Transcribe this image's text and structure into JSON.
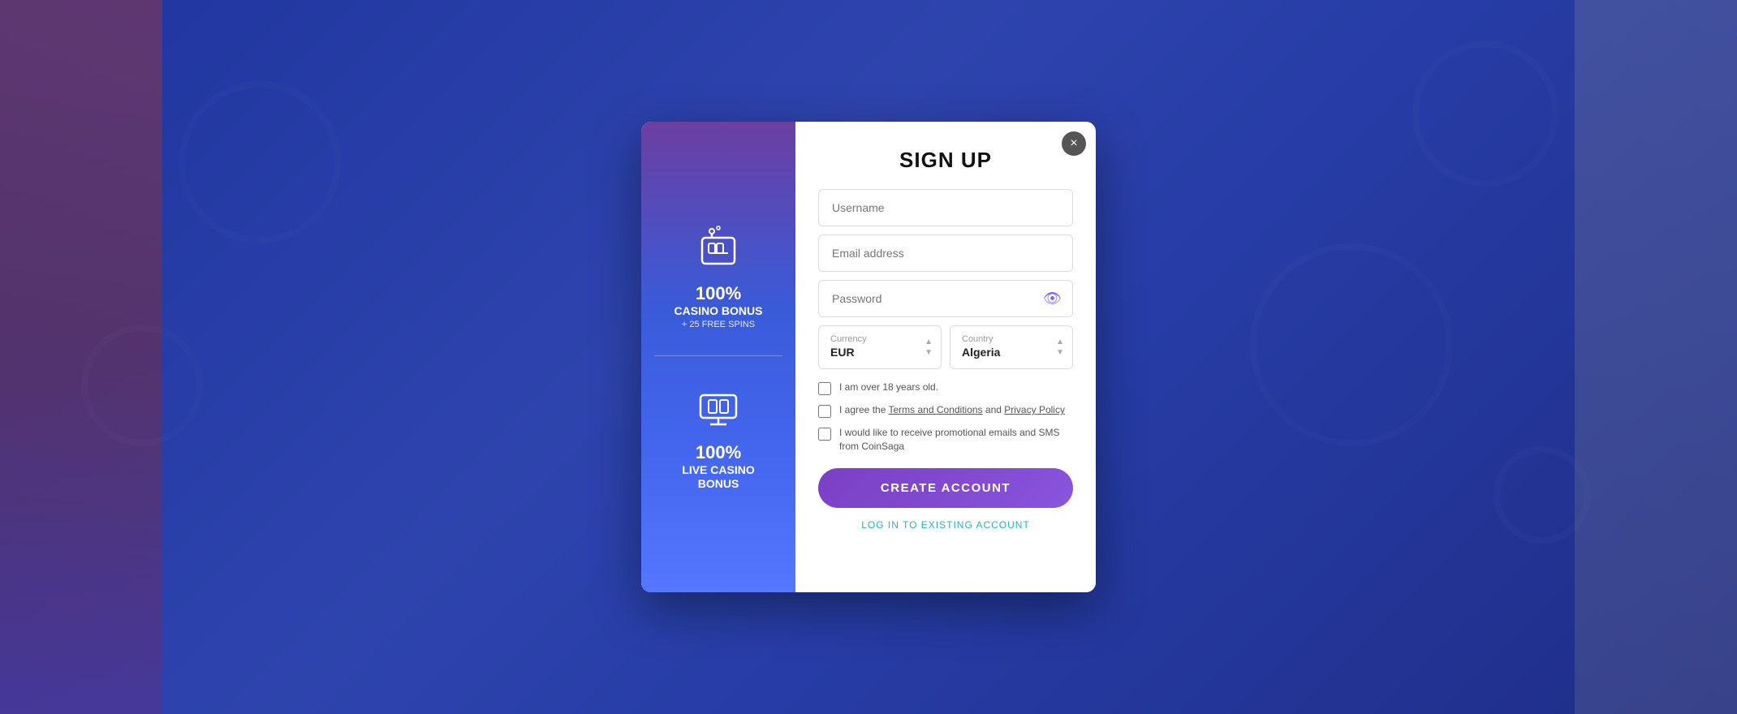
{
  "background": {
    "color": "#3b5bdb"
  },
  "modal": {
    "close_label": "×",
    "title": "SIGN UP",
    "left_panel": {
      "casino_bonus_percent": "100%",
      "casino_bonus_title": "CASINO BONUS",
      "casino_bonus_subtitle": "+ 25 FREE SPINS",
      "live_casino_percent": "100%",
      "live_casino_title": "LIVE CASINO",
      "live_casino_subtitle": "BONUS"
    },
    "form": {
      "username_placeholder": "Username",
      "email_placeholder": "Email address",
      "password_placeholder": "Password",
      "currency_label": "Currency",
      "currency_value": "EUR",
      "country_label": "Country",
      "country_value": "Algeria",
      "checkbox1_label": "I am over 18 years old.",
      "checkbox2_label_pre": "I agree the ",
      "checkbox2_terms": "Terms and Conditions",
      "checkbox2_mid": " and ",
      "checkbox2_privacy": "Privacy Policy",
      "checkbox3_label": "I would like to receive promotional emails and SMS from CoinSaga",
      "create_button": "CREATE ACCOUNT",
      "login_link": "LOG IN TO EXISTING ACCOUNT"
    }
  }
}
